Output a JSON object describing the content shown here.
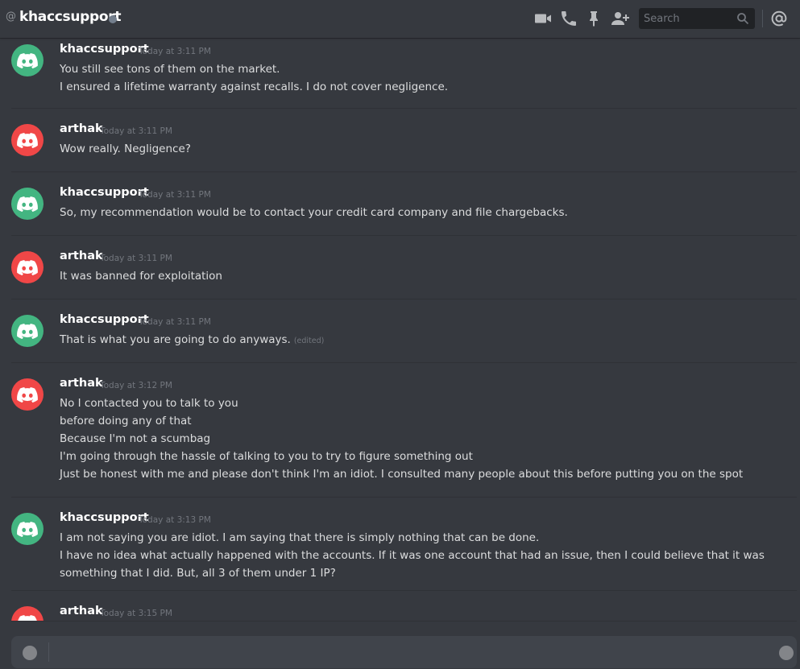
{
  "header": {
    "at_symbol": "@",
    "channel_name": "khaccsupport",
    "status_color": "#747f8d",
    "icons": [
      "video-call-icon",
      "voice-call-icon",
      "pinned-messages-icon",
      "add-friend-icon",
      "mention-icon"
    ]
  },
  "search": {
    "placeholder": "Search"
  },
  "colors": {
    "green_avatar": "#43b581",
    "red_avatar": "#f04747",
    "background": "#36393f"
  },
  "messages": [
    {
      "author": "khaccsupport",
      "timestamp": "Today at 3:11 PM",
      "avatar_color": "#43b581",
      "lines": [
        "You still see tons of them on the market.",
        "I ensured a lifetime warranty against recalls.  I do not cover negligence."
      ]
    },
    {
      "author": "arthak",
      "timestamp": "Today at 3:11 PM",
      "avatar_color": "#f04747",
      "lines": [
        "Wow really. Negligence?"
      ]
    },
    {
      "author": "khaccsupport",
      "timestamp": "Today at 3:11 PM",
      "avatar_color": "#43b581",
      "lines": [
        "So, my recommendation would be to contact your credit card company and file chargebacks."
      ]
    },
    {
      "author": "arthak",
      "timestamp": "Today at 3:11 PM",
      "avatar_color": "#f04747",
      "lines": [
        "It was banned for exploitation"
      ]
    },
    {
      "author": "khaccsupport",
      "timestamp": "Today at 3:11 PM",
      "avatar_color": "#43b581",
      "lines": [
        "That is what you are going to do anyways."
      ],
      "edited": "(edited)"
    },
    {
      "author": "arthak",
      "timestamp": "Today at 3:12 PM",
      "avatar_color": "#f04747",
      "lines": [
        "No I contacted you to talk to you",
        "before doing any of that",
        "Because I'm not a scumbag",
        "I'm going through the hassle of talking to you to try to figure something out",
        "Just be honest with me and please don't think I'm an idiot. I consulted many people about this before putting you on the spot"
      ]
    },
    {
      "author": "khaccsupport",
      "timestamp": "Today at 3:13 PM",
      "avatar_color": "#43b581",
      "lines": [
        "I am not saying you are idiot.  I am saying that there is simply nothing that can be done.",
        "I have no idea what actually happened with the accounts.  If it was one account that had an issue, then I could believe that it was something that I did.  But, all 3 of them under 1 IP?"
      ]
    },
    {
      "author": "arthak",
      "timestamp": "Today at 3:15 PM",
      "avatar_color": "#f04747",
      "lines": []
    }
  ]
}
